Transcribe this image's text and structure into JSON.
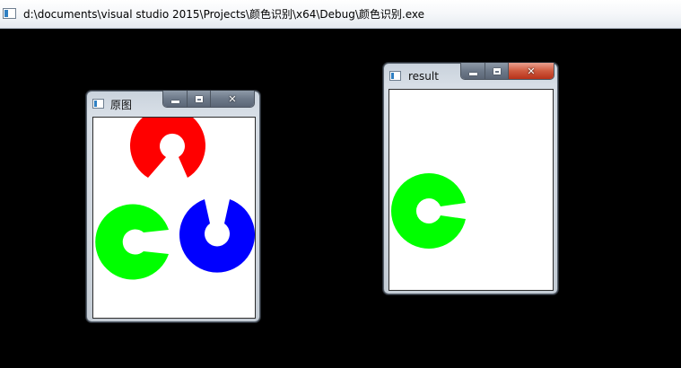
{
  "console": {
    "title": "d:\\documents\\visual studio 2015\\Projects\\颜色识别\\x64\\Debug\\颜色识别.exe",
    "background": "#000000"
  },
  "windows": {
    "original": {
      "title": "原图",
      "close_glyph": "✕",
      "shapes": [
        {
          "icon": "ring-red",
          "color": "#ff0000"
        },
        {
          "icon": "ring-green",
          "color": "#00ff00"
        },
        {
          "icon": "ring-blue",
          "color": "#0000ff"
        }
      ]
    },
    "result": {
      "title": "result",
      "close_glyph": "✕",
      "shapes": [
        {
          "icon": "ring-green",
          "color": "#00ff00"
        }
      ]
    }
  },
  "colors": {
    "red": "#ff0000",
    "green": "#00ff00",
    "blue": "#0000ff",
    "close_active": "#c8452b"
  }
}
